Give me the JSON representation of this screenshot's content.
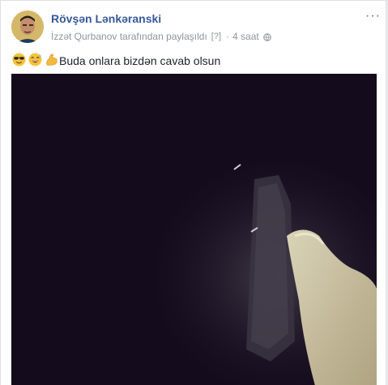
{
  "post": {
    "author": "Rövşən Lənkəranski",
    "shared_by": "İzzət Qurbanov tarafından paylaşıldı",
    "shared_marker": "[?]",
    "separator": "·",
    "time": "4 saat",
    "caption": "Buda onlara bizdən cavab olsun",
    "emojis": [
      "sunglasses-face-emoji",
      "grinning-sweat-emoji",
      "flexed-biceps-emoji"
    ],
    "more_label": "···"
  },
  "colors": {
    "author": "#365899",
    "meta": "#90949c",
    "video_bg": "#120a1a"
  }
}
